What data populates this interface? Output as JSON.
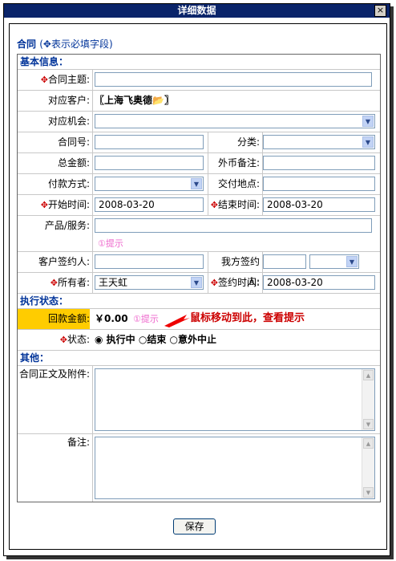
{
  "window": {
    "title": "详细数据",
    "close_glyph": "×"
  },
  "header": {
    "title": "合同",
    "required_note": "(✥表示必填字段)"
  },
  "sections": {
    "basic": "基本信息：",
    "exec": "执行状态：",
    "other": "其他："
  },
  "fields": {
    "subject": {
      "label": "✥合同主题:",
      "value": ""
    },
    "customer": {
      "label": "对应客户:",
      "value": "〖上海飞奥德📂〗"
    },
    "opportunity": {
      "label": "对应机会:",
      "value": ""
    },
    "contract_no": {
      "label": "合同号:",
      "value": ""
    },
    "category": {
      "label": "分类:",
      "value": ""
    },
    "total": {
      "label": "总金额:",
      "value": ""
    },
    "currency_note": {
      "label": "外币备注:",
      "value": ""
    },
    "payment": {
      "label": "付款方式:",
      "value": ""
    },
    "delivery": {
      "label": "交付地点:",
      "value": ""
    },
    "start": {
      "label": "✥开始时间:",
      "value": "2008-03-20"
    },
    "end": {
      "label": "✥结束时间:",
      "value": "2008-03-20"
    },
    "product": {
      "label": "产品/服务:",
      "value": "",
      "hint": "①提示"
    },
    "client_signer": {
      "label": "客户签约人:",
      "value": ""
    },
    "our_signer": {
      "label": "我方签约人:",
      "value": ""
    },
    "owner": {
      "label": "✥所有者:",
      "value": "王天虹"
    },
    "sign_date": {
      "label": "✥签约时间:",
      "value": "2008-03-20"
    },
    "collected": {
      "label": "回款金额:",
      "value": "￥0.00",
      "hint": "①提示"
    },
    "status": {
      "label": "✥状态:",
      "options": [
        "执行中",
        "结束",
        "意外中止"
      ]
    },
    "attachment": {
      "label": "合同正文及附件:"
    },
    "remarks": {
      "label": "备注:"
    }
  },
  "annotation": "鼠标移动到此，查看提示",
  "save_label": "保存",
  "colors": {
    "title_bar": "#0a246a",
    "section": "#003399",
    "highlight": "#ffcc00",
    "hint": "#ee66cc",
    "annotation": "#cc0000"
  }
}
